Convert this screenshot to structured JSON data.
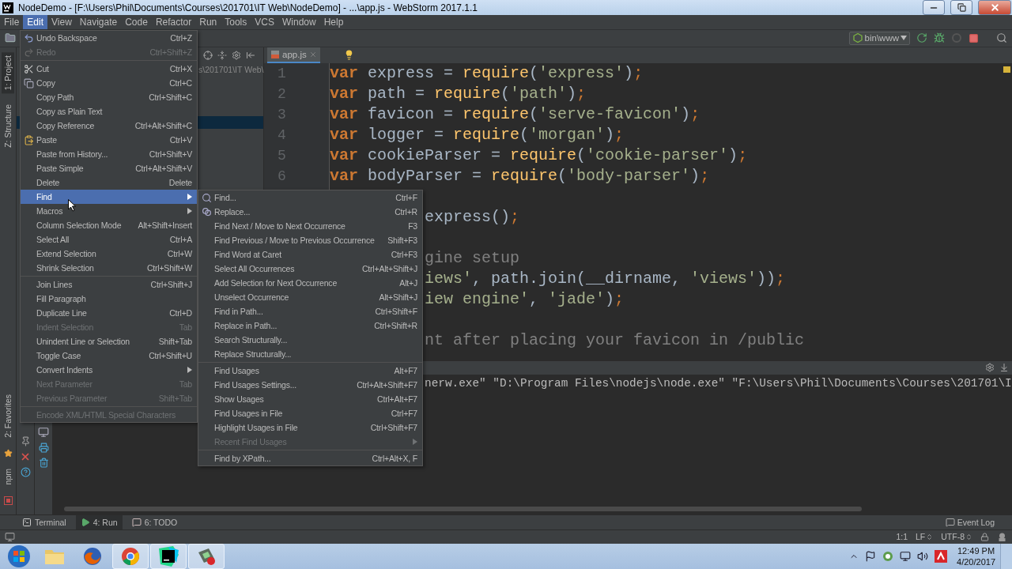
{
  "window": {
    "title": "NodeDemo - [F:\\Users\\Phil\\Documents\\Courses\\201701\\IT Web\\NodeDemo] - ...\\app.js - WebStorm 2017.1.1"
  },
  "menu_bar": [
    {
      "label": "File",
      "selected": false
    },
    {
      "label": "Edit",
      "selected": true
    },
    {
      "label": "View",
      "selected": false
    },
    {
      "label": "Navigate",
      "selected": false
    },
    {
      "label": "Code",
      "selected": false
    },
    {
      "label": "Refactor",
      "selected": false
    },
    {
      "label": "Run",
      "selected": false
    },
    {
      "label": "Tools",
      "selected": false
    },
    {
      "label": "VCS",
      "selected": false
    },
    {
      "label": "Window",
      "selected": false
    },
    {
      "label": "Help",
      "selected": false
    }
  ],
  "toolbar": {
    "run_config": "bin\\www"
  },
  "tool_strip": {
    "top": [
      {
        "label": "1: Project",
        "selected": true
      },
      {
        "label": "Z: Structure",
        "selected": false
      }
    ],
    "bottom": [
      {
        "label": "2: Favorites",
        "selected": false
      },
      {
        "label": "npm",
        "selected": false
      }
    ]
  },
  "project_panel": {
    "path": "s\\201701\\IT Web\\"
  },
  "editor": {
    "tabs": [
      {
        "label": "app.js",
        "selected": true
      }
    ],
    "lines": [
      {
        "kind": "full",
        "number": "1",
        "tokens": [
          {
            "kind": "keyword",
            "text": "var"
          },
          {
            "kind": "plain",
            "text": " express = "
          },
          {
            "kind": "function",
            "text": "require"
          },
          {
            "kind": "plain",
            "text": "("
          },
          {
            "kind": "string",
            "text": "'express'"
          },
          {
            "kind": "plain",
            "text": ")"
          },
          {
            "kind": "punct",
            "text": ";"
          }
        ]
      },
      {
        "kind": "full",
        "number": "2",
        "tokens": [
          {
            "kind": "keyword",
            "text": "var"
          },
          {
            "kind": "plain",
            "text": " path = "
          },
          {
            "kind": "function",
            "text": "require"
          },
          {
            "kind": "plain",
            "text": "("
          },
          {
            "kind": "string",
            "text": "'path'"
          },
          {
            "kind": "plain",
            "text": ")"
          },
          {
            "kind": "punct",
            "text": ";"
          }
        ]
      },
      {
        "kind": "full",
        "number": "3",
        "tokens": [
          {
            "kind": "keyword",
            "text": "var"
          },
          {
            "kind": "plain",
            "text": " favicon = "
          },
          {
            "kind": "function",
            "text": "require"
          },
          {
            "kind": "plain",
            "text": "("
          },
          {
            "kind": "string",
            "text": "'serve-favicon'"
          },
          {
            "kind": "plain",
            "text": ")"
          },
          {
            "kind": "punct",
            "text": ";"
          }
        ]
      },
      {
        "kind": "full",
        "number": "4",
        "tokens": [
          {
            "kind": "keyword",
            "text": "var"
          },
          {
            "kind": "plain",
            "text": " logger = "
          },
          {
            "kind": "function",
            "text": "require"
          },
          {
            "kind": "plain",
            "text": "("
          },
          {
            "kind": "string",
            "text": "'morgan'"
          },
          {
            "kind": "plain",
            "text": ")"
          },
          {
            "kind": "punct",
            "text": ";"
          }
        ]
      },
      {
        "kind": "full",
        "number": "5",
        "tokens": [
          {
            "kind": "keyword",
            "text": "var"
          },
          {
            "kind": "plain",
            "text": " cookieParser = "
          },
          {
            "kind": "function",
            "text": "require"
          },
          {
            "kind": "plain",
            "text": "("
          },
          {
            "kind": "string",
            "text": "'cookie-parser'"
          },
          {
            "kind": "plain",
            "text": ")"
          },
          {
            "kind": "punct",
            "text": ";"
          }
        ]
      },
      {
        "kind": "full",
        "number": "6",
        "tokens": [
          {
            "kind": "keyword",
            "text": "var"
          },
          {
            "kind": "plain",
            "text": " bodyParser = "
          },
          {
            "kind": "function",
            "text": "require"
          },
          {
            "kind": "plain",
            "text": "("
          },
          {
            "kind": "string",
            "text": "'body-parser'"
          },
          {
            "kind": "plain",
            "text": ")"
          },
          {
            "kind": "punct",
            "text": ";"
          }
        ]
      },
      {
        "kind": "blank"
      },
      {
        "kind": "clipped",
        "tokens": [
          {
            "kind": "plain",
            "text": "express()"
          },
          {
            "kind": "punct",
            "text": ";"
          }
        ]
      },
      {
        "kind": "blank"
      },
      {
        "kind": "clipped",
        "tokens": [
          {
            "kind": "comment",
            "text": "gine setup"
          }
        ]
      },
      {
        "kind": "clipped",
        "tokens": [
          {
            "kind": "string",
            "text": "iews'"
          },
          {
            "kind": "plain",
            "text": ", path.join(__dirname, "
          },
          {
            "kind": "string",
            "text": "'views'"
          },
          {
            "kind": "plain",
            "text": "))"
          },
          {
            "kind": "punct",
            "text": ";"
          }
        ]
      },
      {
        "kind": "clipped",
        "tokens": [
          {
            "kind": "string",
            "text": "iew engine'"
          },
          {
            "kind": "plain",
            "text": ", "
          },
          {
            "kind": "string",
            "text": "'jade'"
          },
          {
            "kind": "plain",
            "text": ")"
          },
          {
            "kind": "punct",
            "text": ";"
          }
        ]
      },
      {
        "kind": "blank"
      },
      {
        "kind": "clipped",
        "tokens": [
          {
            "kind": "comment",
            "text": "nt after placing your favicon in /public"
          }
        ]
      }
    ]
  },
  "run_panel": {
    "console": "nerw.exe\" \"D:\\Program Files\\nodejs\\node.exe\" \"F:\\Users\\Phil\\Documents\\Courses\\201701\\I"
  },
  "tool_tabs": [
    {
      "label": "Terminal",
      "selected": false
    },
    {
      "label": "4: Run",
      "selected": true
    },
    {
      "label": "6: TODO",
      "selected": false
    }
  ],
  "event_log": "Event Log",
  "status_bar": {
    "position": "1:1",
    "line_separator": "LF",
    "encoding": "UTF-8"
  },
  "edit_menu": {
    "items": [
      {
        "kind": "item",
        "label": "Undo Backspace",
        "shortcut": "Ctrl+Z",
        "disabled": false,
        "selected": false
      },
      {
        "kind": "item",
        "label": "Redo",
        "shortcut": "Ctrl+Shift+Z",
        "disabled": true,
        "selected": false
      },
      {
        "kind": "separator"
      },
      {
        "kind": "item",
        "label": "Cut",
        "shortcut": "Ctrl+X",
        "disabled": false,
        "selected": false
      },
      {
        "kind": "item",
        "label": "Copy",
        "shortcut": "Ctrl+C",
        "disabled": false,
        "selected": false
      },
      {
        "kind": "item",
        "label": "Copy Path",
        "shortcut": "Ctrl+Shift+C",
        "disabled": false,
        "selected": false
      },
      {
        "kind": "item",
        "label": "Copy as Plain Text",
        "disabled": false,
        "selected": false
      },
      {
        "kind": "item",
        "label": "Copy Reference",
        "shortcut": "Ctrl+Alt+Shift+C",
        "disabled": false,
        "selected": false
      },
      {
        "kind": "item",
        "label": "Paste",
        "shortcut": "Ctrl+V",
        "disabled": false,
        "selected": false
      },
      {
        "kind": "item",
        "label": "Paste from History...",
        "shortcut": "Ctrl+Shift+V",
        "disabled": false,
        "selected": false
      },
      {
        "kind": "item",
        "label": "Paste Simple",
        "shortcut": "Ctrl+Alt+Shift+V",
        "disabled": false,
        "selected": false
      },
      {
        "kind": "item",
        "label": "Delete",
        "shortcut": "Delete",
        "disabled": false,
        "selected": false
      },
      {
        "kind": "submenu",
        "label": "Find",
        "disabled": false,
        "selected": true
      },
      {
        "kind": "submenu",
        "label": "Macros",
        "disabled": false,
        "selected": false
      },
      {
        "kind": "item",
        "label": "Column Selection Mode",
        "shortcut": "Alt+Shift+Insert",
        "disabled": false,
        "selected": false
      },
      {
        "kind": "item",
        "label": "Select All",
        "shortcut": "Ctrl+A",
        "disabled": false,
        "selected": false
      },
      {
        "kind": "item",
        "label": "Extend Selection",
        "shortcut": "Ctrl+W",
        "disabled": false,
        "selected": false
      },
      {
        "kind": "item",
        "label": "Shrink Selection",
        "shortcut": "Ctrl+Shift+W",
        "disabled": false,
        "selected": false
      },
      {
        "kind": "separator"
      },
      {
        "kind": "item",
        "label": "Join Lines",
        "shortcut": "Ctrl+Shift+J",
        "disabled": false,
        "selected": false
      },
      {
        "kind": "item",
        "label": "Fill Paragraph",
        "disabled": false,
        "selected": false
      },
      {
        "kind": "item",
        "label": "Duplicate Line",
        "shortcut": "Ctrl+D",
        "disabled": false,
        "selected": false
      },
      {
        "kind": "item",
        "label": "Indent Selection",
        "shortcut": "Tab",
        "disabled": true,
        "selected": false
      },
      {
        "kind": "item",
        "label": "Unindent Line or Selection",
        "shortcut": "Shift+Tab",
        "disabled": false,
        "selected": false
      },
      {
        "kind": "item",
        "label": "Toggle Case",
        "shortcut": "Ctrl+Shift+U",
        "disabled": false,
        "selected": false
      },
      {
        "kind": "submenu",
        "label": "Convert Indents",
        "disabled": false,
        "selected": false
      },
      {
        "kind": "item",
        "label": "Next Parameter",
        "shortcut": "Tab",
        "disabled": true,
        "selected": false
      },
      {
        "kind": "item",
        "label": "Previous Parameter",
        "shortcut": "Shift+Tab",
        "disabled": true,
        "selected": false
      },
      {
        "kind": "separator"
      },
      {
        "kind": "item",
        "label": "Encode XML/HTML Special Characters",
        "disabled": true,
        "selected": false
      }
    ]
  },
  "find_submenu": {
    "items": [
      {
        "kind": "item",
        "label": "Find...",
        "shortcut": "Ctrl+F",
        "disabled": false,
        "selected": false
      },
      {
        "kind": "item",
        "label": "Replace...",
        "shortcut": "Ctrl+R",
        "disabled": false,
        "selected": false
      },
      {
        "kind": "item",
        "label": "Find Next / Move to Next Occurrence",
        "shortcut": "F3",
        "disabled": false,
        "selected": false
      },
      {
        "kind": "item",
        "label": "Find Previous / Move to Previous Occurrence",
        "shortcut": "Shift+F3",
        "disabled": false,
        "selected": false
      },
      {
        "kind": "item",
        "label": "Find Word at Caret",
        "shortcut": "Ctrl+F3",
        "disabled": false,
        "selected": false
      },
      {
        "kind": "item",
        "label": "Select All Occurrences",
        "shortcut": "Ctrl+Alt+Shift+J",
        "disabled": false,
        "selected": false
      },
      {
        "kind": "item",
        "label": "Add Selection for Next Occurrence",
        "shortcut": "Alt+J",
        "disabled": false,
        "selected": false
      },
      {
        "kind": "item",
        "label": "Unselect Occurrence",
        "shortcut": "Alt+Shift+J",
        "disabled": false,
        "selected": false
      },
      {
        "kind": "item",
        "label": "Find in Path...",
        "shortcut": "Ctrl+Shift+F",
        "disabled": false,
        "selected": false
      },
      {
        "kind": "item",
        "label": "Replace in Path...",
        "shortcut": "Ctrl+Shift+R",
        "disabled": false,
        "selected": false
      },
      {
        "kind": "item",
        "label": "Search Structurally...",
        "disabled": false,
        "selected": false
      },
      {
        "kind": "item",
        "label": "Replace Structurally...",
        "disabled": false,
        "selected": false
      },
      {
        "kind": "separator"
      },
      {
        "kind": "item",
        "label": "Find Usages",
        "shortcut": "Alt+F7",
        "disabled": false,
        "selected": false
      },
      {
        "kind": "item",
        "label": "Find Usages Settings...",
        "shortcut": "Ctrl+Alt+Shift+F7",
        "disabled": false,
        "selected": false
      },
      {
        "kind": "item",
        "label": "Show Usages",
        "shortcut": "Ctrl+Alt+F7",
        "disabled": false,
        "selected": false
      },
      {
        "kind": "item",
        "label": "Find Usages in File",
        "shortcut": "Ctrl+F7",
        "disabled": false,
        "selected": false
      },
      {
        "kind": "item",
        "label": "Highlight Usages in File",
        "shortcut": "Ctrl+Shift+F7",
        "disabled": false,
        "selected": false
      },
      {
        "kind": "submenu",
        "label": "Recent Find Usages",
        "disabled": true,
        "selected": false
      },
      {
        "kind": "separator"
      },
      {
        "kind": "item",
        "label": "Find by XPath...",
        "shortcut": "Ctrl+Alt+X, F",
        "disabled": false,
        "selected": false
      }
    ]
  },
  "taskbar": {
    "apps": [
      {
        "kind": "folder",
        "active": false
      },
      {
        "kind": "firefox",
        "active": false
      },
      {
        "kind": "chrome",
        "active": true
      },
      {
        "kind": "webstorm",
        "active": true
      },
      {
        "kind": "tool",
        "active": true
      }
    ],
    "time": "12:49 PM",
    "date": "4/20/2017"
  }
}
